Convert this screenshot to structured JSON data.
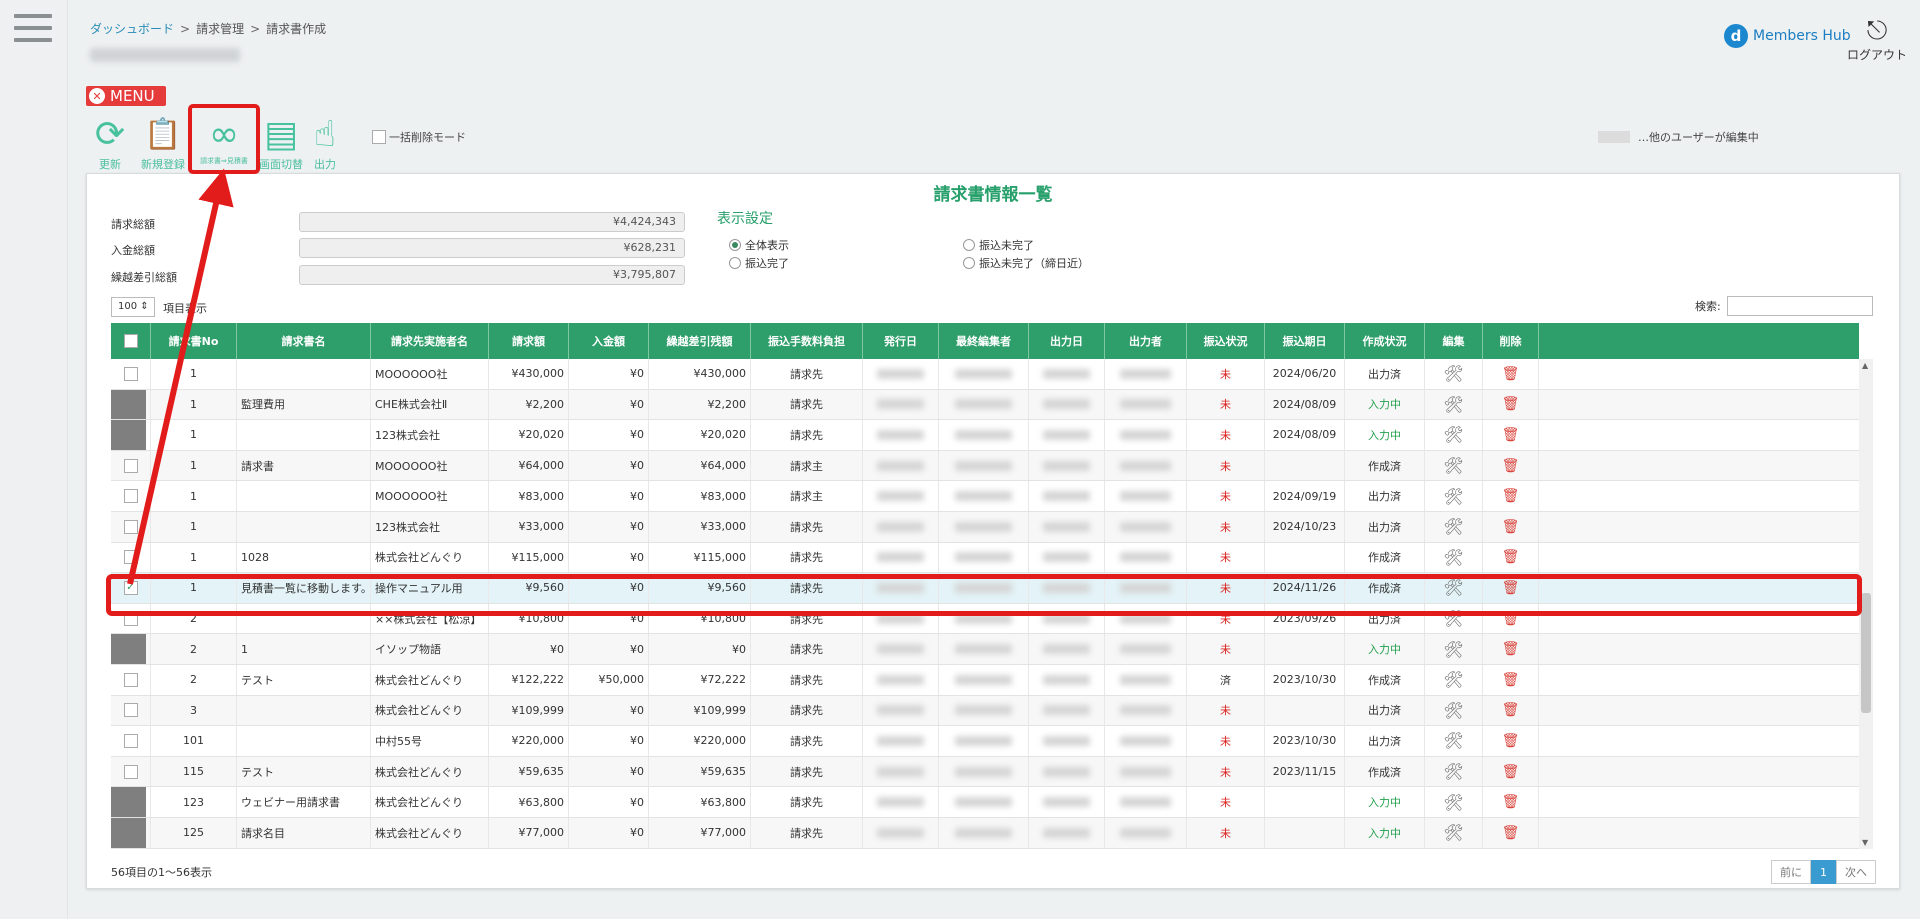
{
  "breadcrumb": {
    "dashboard": "ダッシュボード",
    "billing": "請求管理",
    "current": "請求書作成",
    "sep": ">"
  },
  "brand": {
    "logo_mark": "d",
    "logo_text": "Members Hub"
  },
  "logout": {
    "icon": "⎋",
    "label": "ログアウト"
  },
  "menu": {
    "label": "MENU",
    "close": "✕"
  },
  "toolbar": {
    "refresh": {
      "label": "更新",
      "glyph": "⟳"
    },
    "new": {
      "label": "新規登録",
      "glyph": "📋"
    },
    "convert": {
      "label": "請求書⇒見積書",
      "glyph": "∞"
    },
    "switch": {
      "label": "画面切替",
      "glyph": "▤"
    },
    "output": {
      "label": "出力",
      "glyph": "☝"
    }
  },
  "bulk_delete_label": "一括削除モード",
  "editing_label": "…他のユーザーが編集中",
  "panel": {
    "title": "請求書情報一覧"
  },
  "summary": [
    {
      "label": "請求総額",
      "value": "¥4,424,343"
    },
    {
      "label": "入金総額",
      "value": "¥628,231"
    },
    {
      "label": "繰越差引総額",
      "value": "¥3,795,807"
    }
  ],
  "display": {
    "title": "表示設定",
    "options": [
      "全体表示",
      "振込未完了",
      "振込完了",
      "振込未完了（締日近）"
    ]
  },
  "page_size": "100 ⇕",
  "page_size_label": "項目表示",
  "search_label": "検索:",
  "columns": [
    "請求書No",
    "請求書名",
    "請求先実施者名",
    "請求額",
    "入金額",
    "繰越差引残額",
    "振込手数料負担",
    "発行日",
    "最終編集者",
    "出力日",
    "出力者",
    "振込状況",
    "振込期日",
    "作成状況",
    "編集",
    "削除"
  ],
  "rows": [
    {
      "no": "1",
      "name": "",
      "client": "MOOOOOO社",
      "amt": "¥430,000",
      "paid": "¥0",
      "bal": "¥430,000",
      "fee": "請求先",
      "status": "未",
      "due": "2024/06/20",
      "state": "出力済",
      "chk": "white"
    },
    {
      "no": "1",
      "name": "監理費用",
      "client": "CHE株式会社Ⅱ",
      "amt": "¥2,200",
      "paid": "¥0",
      "bal": "¥2,200",
      "fee": "請求先",
      "status": "未",
      "due": "2024/08/09",
      "state": "入力中",
      "chk": "gray"
    },
    {
      "no": "1",
      "name": "",
      "client": "123株式会社",
      "amt": "¥20,020",
      "paid": "¥0",
      "bal": "¥20,020",
      "fee": "請求先",
      "status": "未",
      "due": "2024/08/09",
      "state": "入力中",
      "chk": "gray"
    },
    {
      "no": "1",
      "name": "請求書",
      "client": "MOOOOOO社",
      "amt": "¥64,000",
      "paid": "¥0",
      "bal": "¥64,000",
      "fee": "請求主",
      "status": "未",
      "due": "",
      "state": "作成済",
      "chk": "white"
    },
    {
      "no": "1",
      "name": "",
      "client": "MOOOOOO社",
      "amt": "¥83,000",
      "paid": "¥0",
      "bal": "¥83,000",
      "fee": "請求主",
      "status": "未",
      "due": "2024/09/19",
      "state": "出力済",
      "chk": "white"
    },
    {
      "no": "1",
      "name": "",
      "client": "123株式会社",
      "amt": "¥33,000",
      "paid": "¥0",
      "bal": "¥33,000",
      "fee": "請求先",
      "status": "未",
      "due": "2024/10/23",
      "state": "出力済",
      "chk": "white"
    },
    {
      "no": "1",
      "name": "1028",
      "client": "株式会社どんぐり",
      "amt": "¥115,000",
      "paid": "¥0",
      "bal": "¥115,000",
      "fee": "請求先",
      "status": "未",
      "due": "",
      "state": "作成済",
      "chk": "white"
    },
    {
      "no": "1",
      "name": "見積書一覧に移動します。",
      "client": "操作マニュアル用",
      "amt": "¥9,560",
      "paid": "¥0",
      "bal": "¥9,560",
      "fee": "請求先",
      "status": "未",
      "due": "2024/11/26",
      "state": "作成済",
      "chk": "tick",
      "highlight": true
    },
    {
      "no": "2",
      "name": "",
      "client": "××株式会社【松涼】",
      "amt": "¥10,800",
      "paid": "¥0",
      "bal": "¥10,800",
      "fee": "請求先",
      "status": "未",
      "due": "2023/09/26",
      "state": "出力済",
      "chk": "white"
    },
    {
      "no": "2",
      "name": "1",
      "client": "イソップ物語",
      "amt": "¥0",
      "paid": "¥0",
      "bal": "¥0",
      "fee": "請求先",
      "status": "未",
      "due": "",
      "state": "入力中",
      "chk": "gray"
    },
    {
      "no": "2",
      "name": "テスト",
      "client": "株式会社どんぐり",
      "amt": "¥122,222",
      "paid": "¥50,000",
      "bal": "¥72,222",
      "fee": "請求先",
      "status": "済",
      "due": "2023/10/30",
      "state": "作成済",
      "chk": "white"
    },
    {
      "no": "3",
      "name": "",
      "client": "株式会社どんぐり",
      "amt": "¥109,999",
      "paid": "¥0",
      "bal": "¥109,999",
      "fee": "請求先",
      "status": "未",
      "due": "",
      "state": "出力済",
      "chk": "white"
    },
    {
      "no": "101",
      "name": "",
      "client": "中村55号",
      "amt": "¥220,000",
      "paid": "¥0",
      "bal": "¥220,000",
      "fee": "請求先",
      "status": "未",
      "due": "2023/10/30",
      "state": "出力済",
      "chk": "white"
    },
    {
      "no": "115",
      "name": "テスト",
      "client": "株式会社どんぐり",
      "amt": "¥59,635",
      "paid": "¥0",
      "bal": "¥59,635",
      "fee": "請求先",
      "status": "未",
      "due": "2023/11/15",
      "state": "作成済",
      "chk": "white"
    },
    {
      "no": "123",
      "name": "ウェビナー用請求書",
      "client": "株式会社どんぐり",
      "amt": "¥63,800",
      "paid": "¥0",
      "bal": "¥63,800",
      "fee": "請求先",
      "status": "未",
      "due": "",
      "state": "入力中",
      "chk": "gray"
    },
    {
      "no": "125",
      "name": "請求名目",
      "client": "株式会社どんぐり",
      "amt": "¥77,000",
      "paid": "¥0",
      "bal": "¥77,000",
      "fee": "請求先",
      "status": "未",
      "due": "",
      "state": "入力中",
      "chk": "gray"
    }
  ],
  "icons": {
    "edit": "🛠",
    "delete": "🗑",
    "tick": "✓",
    "sort": "⇅",
    "up": "▲",
    "down": "▼"
  },
  "footer": {
    "count": "56項目の1～56表示",
    "prev": "前に",
    "page": "1",
    "next": "次へ"
  },
  "colors": {
    "accent": "#2e9e6a",
    "alert": "#e21b1b",
    "pending": "#d9231f",
    "in_progress": "#23a14d"
  }
}
